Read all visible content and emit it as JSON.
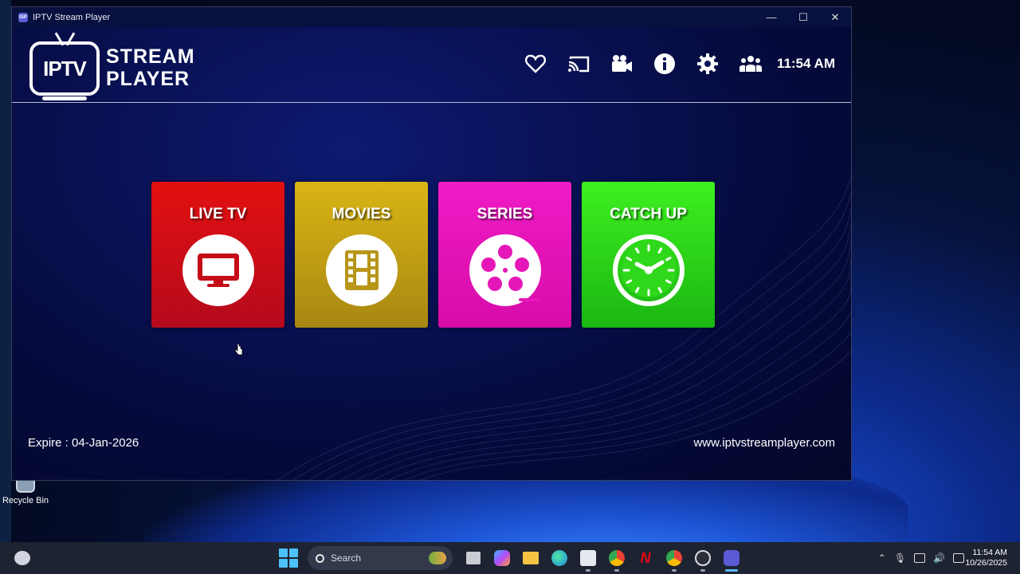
{
  "window": {
    "title": "IPTV Stream Player",
    "logo_badge": "IPTV",
    "logo_line1": "STREAM",
    "logo_line2": "PLAYER",
    "controls": {
      "minimize": "—",
      "maximize": "☐",
      "close": "✕"
    }
  },
  "toolbar": {
    "icons": [
      "heart-icon",
      "cast-icon",
      "video-camera-icon",
      "info-icon",
      "gear-icon",
      "users-icon"
    ],
    "clock": "11:54 AM"
  },
  "tiles": [
    {
      "label": "LIVE TV",
      "icon": "tv-icon",
      "color": "#d80e14"
    },
    {
      "label": "MOVIES",
      "icon": "film-strip-icon",
      "color": "#c7a314"
    },
    {
      "label": "SERIES",
      "icon": "film-reel-icon",
      "color": "#e617b9"
    },
    {
      "label": "CATCH UP",
      "icon": "clock-icon",
      "color": "#2fd81a"
    }
  ],
  "footer": {
    "expire": "Expire : 04-Jan-2026",
    "website": "www.iptvstreamplayer.com"
  },
  "desktop": {
    "recycle_bin": "Recycle Bin"
  },
  "taskbar": {
    "search_placeholder": "Search",
    "time": "11:54 AM",
    "date": "10/26/2025",
    "apps": [
      "file-explorer-icon",
      "copilot-icon",
      "folder-icon",
      "edge-icon",
      "store-icon",
      "chrome-icon",
      "netflix-icon",
      "chrome-profile-icon",
      "github-icon",
      "iptv-app-icon"
    ]
  },
  "colors": {
    "accent_blue": "#4cc2ff",
    "window_bg": "#091257"
  }
}
